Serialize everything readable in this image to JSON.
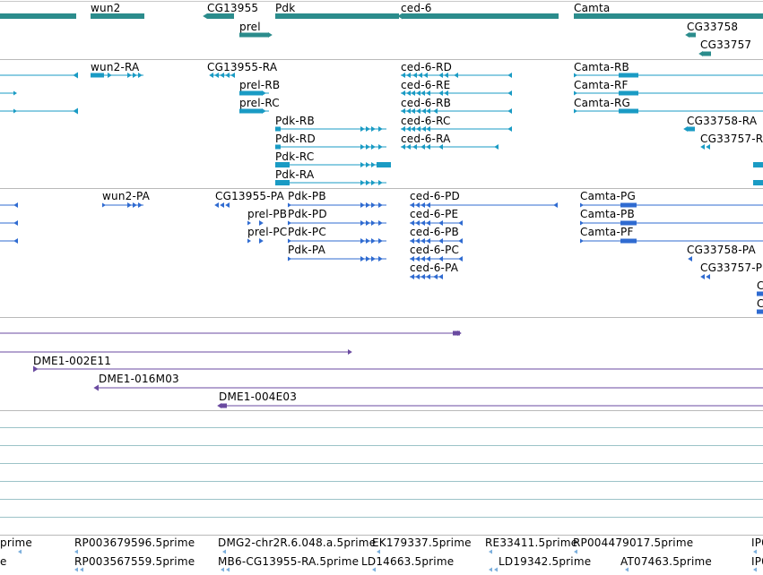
{
  "colors": {
    "gene": "#2b8c8c",
    "transcript_dm": "#1a9bc4",
    "transcript_pa": "#2f6bd1",
    "clone": "#6a4aa0",
    "est": "#7aaedc",
    "separator": "#b9b9b9"
  },
  "gene_track": {
    "labels": [
      "wun2",
      "CG13955",
      "Pdk",
      "ced-6",
      "Camta",
      "prel",
      "CG33758",
      "CG33757"
    ]
  },
  "transcripts_dm": {
    "labels": [
      "wun2-RA",
      "CG13955-RA",
      "ced-6-RD",
      "Camta-RB",
      "prel-RB",
      "ced-6-RE",
      "Camta-RF",
      "prel-RC",
      "ced-6-RB",
      "Camta-RG",
      "Pdk-RB",
      "ced-6-RC",
      "CG33758-RA",
      "Pdk-RD",
      "ced-6-RA",
      "CG33757-R",
      "Pdk-RC",
      "Pdk-RA"
    ]
  },
  "transcripts_pa": {
    "labels": [
      "wun2-PA",
      "CG13955-PA",
      "Pdk-PB",
      "ced-6-PD",
      "Camta-PG",
      "prel-PB",
      "Pdk-PD",
      "ced-6-PE",
      "Camta-PB",
      "prel-PC",
      "Pdk-PC",
      "ced-6-PB",
      "Camta-PF",
      "Pdk-PA",
      "ced-6-PC",
      "CG33758-PA",
      "ced-6-PA",
      "CG33757-P",
      "C",
      "C"
    ]
  },
  "clones": {
    "labels": [
      "DME1-002E11",
      "DME1-016M03",
      "DME1-004E03"
    ]
  },
  "ests": {
    "row1": [
      "prime",
      "RP003679596.5prime",
      "DMG2-chr2R.6.048.a.5prime",
      "EK179337.5prime",
      "RE33411.5prime",
      "RP004479017.5prime",
      "IP0"
    ],
    "row2": [
      "e",
      "RP003567559.5prime",
      "MB6-CG13955-RA.5prime",
      "LD14663.5prime",
      "LD19342.5prime",
      "AT07463.5prime",
      "IP0"
    ]
  }
}
